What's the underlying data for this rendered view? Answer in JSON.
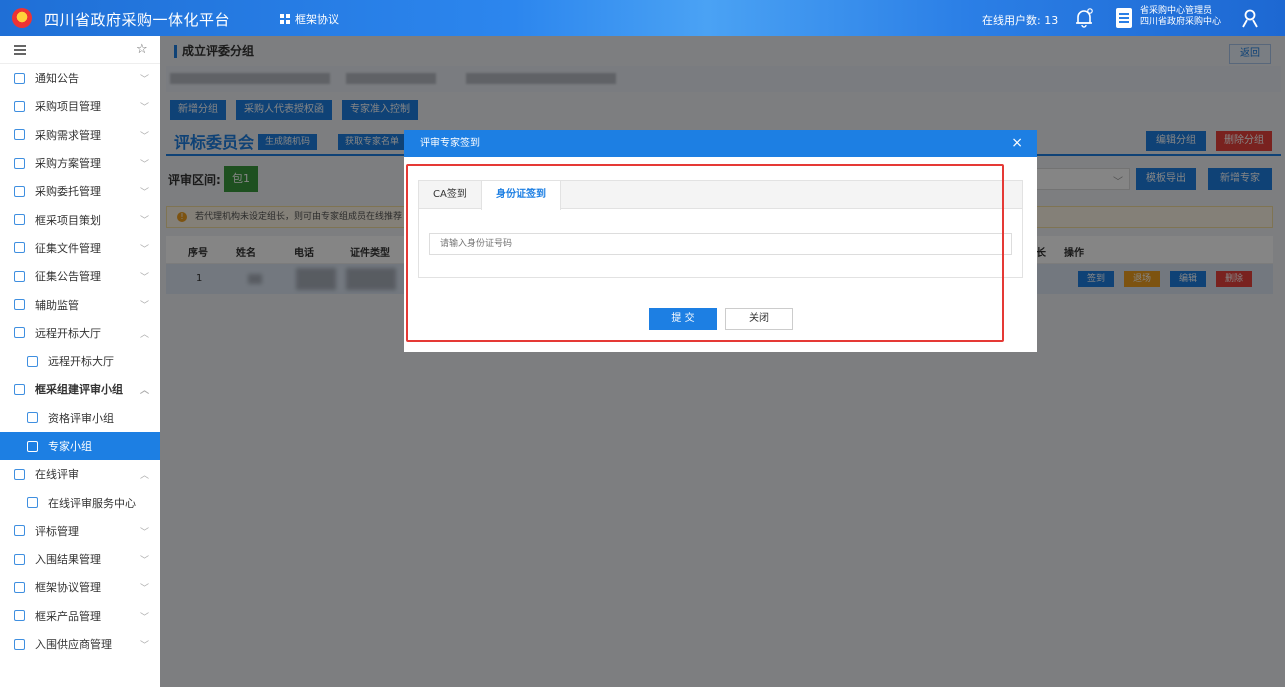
{
  "header": {
    "app_title": "四川省政府采购一体化平台",
    "nav_label": "框架协议",
    "online_users": "在线用户数: 13",
    "user_role": "省采购中心管理员",
    "user_org": "四川省政府采购中心"
  },
  "sidebar": {
    "items": [
      {
        "label": "通知公告"
      },
      {
        "label": "采购项目管理"
      },
      {
        "label": "采购需求管理"
      },
      {
        "label": "采购方案管理"
      },
      {
        "label": "采购委托管理"
      },
      {
        "label": "框采项目策划"
      },
      {
        "label": "征集文件管理"
      },
      {
        "label": "征集公告管理"
      },
      {
        "label": "辅助监管"
      },
      {
        "label": "远程开标大厅"
      },
      {
        "label": "远程开标大厅"
      },
      {
        "label": "框采组建评审小组"
      },
      {
        "label": "资格评审小组"
      },
      {
        "label": "专家小组"
      },
      {
        "label": "在线评审"
      },
      {
        "label": "在线评审服务中心"
      },
      {
        "label": "评标管理"
      },
      {
        "label": "入围结果管理"
      },
      {
        "label": "框架协议管理"
      },
      {
        "label": "框采产品管理"
      },
      {
        "label": "入围供应商管理"
      }
    ]
  },
  "main": {
    "page_title": "成立评委分组",
    "back_label": "返回",
    "buttons": {
      "add_group": "新增分组",
      "buyer_auth": "采购人代表授权函",
      "expert_access": "专家准入控制"
    },
    "committee_title": "评标委员会",
    "gen_random": "生成随机码",
    "get_expert_list": "获取专家名单",
    "edit_group": "编辑分组",
    "delete_group": "删除分组",
    "review_range_label": "评审区间:",
    "package": "包1",
    "template_export": "模板导出",
    "add_expert": "新增专家",
    "notice": "若代理机构未设定组长，则可由专家组成员在线推荐",
    "table": {
      "headers": [
        "序号",
        "姓名",
        "电话",
        "证件类型",
        "长",
        "操作"
      ],
      "row": {
        "index": "1",
        "actions": [
          "签到",
          "退场",
          "编辑",
          "删除"
        ]
      }
    }
  },
  "modal": {
    "title": "评审专家签到",
    "close_icon": "×",
    "tabs": [
      "CA签到",
      "身份证签到"
    ],
    "active_tab": 1,
    "id_placeholder": "请输入身份证号码",
    "submit": "提 交",
    "close": "关闭"
  },
  "colors": {
    "primary": "#1d7fe3",
    "danger": "#e8423c",
    "warning": "#f0a020",
    "success": "#3a9a3f",
    "highlight": "#e53935"
  }
}
